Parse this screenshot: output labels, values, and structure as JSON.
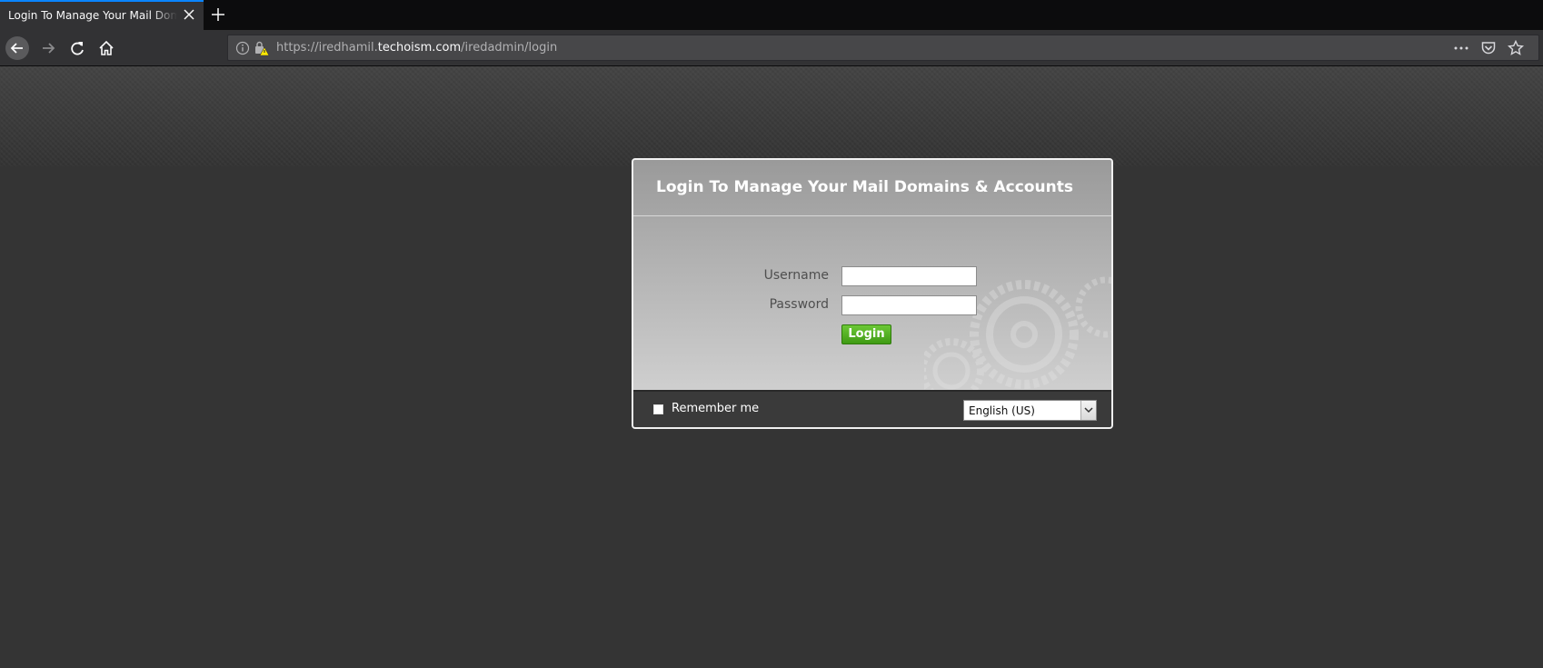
{
  "browser": {
    "tab": {
      "title": "Login To Manage Your Mail Domains & Accounts"
    },
    "address": {
      "url_prefix": "https://iredhamil.",
      "url_domain": "techoism.com",
      "url_path": "/iredadmin/login"
    },
    "icons": {
      "close_tab": "close-icon",
      "new_tab": "plus-icon",
      "back": "arrow-left-icon",
      "forward": "arrow-right-icon",
      "reload": "reload-icon",
      "home": "home-icon",
      "site_info": "info-icon",
      "insecure_lock": "lock-warning-icon",
      "page_actions": "more-icon",
      "pocket": "pocket-icon",
      "bookmark": "star-icon"
    }
  },
  "login": {
    "title": "Login To Manage Your Mail Domains & Accounts",
    "username_label": "Username",
    "username_value": "",
    "password_label": "Password",
    "password_value": "",
    "submit_label": "Login",
    "remember_label": "Remember me",
    "remember_checked": false,
    "language_selected": "English (US)"
  },
  "colors": {
    "accent_tab": "#0a84ff",
    "login_button": "#4fb021",
    "page_background": "#343434"
  }
}
